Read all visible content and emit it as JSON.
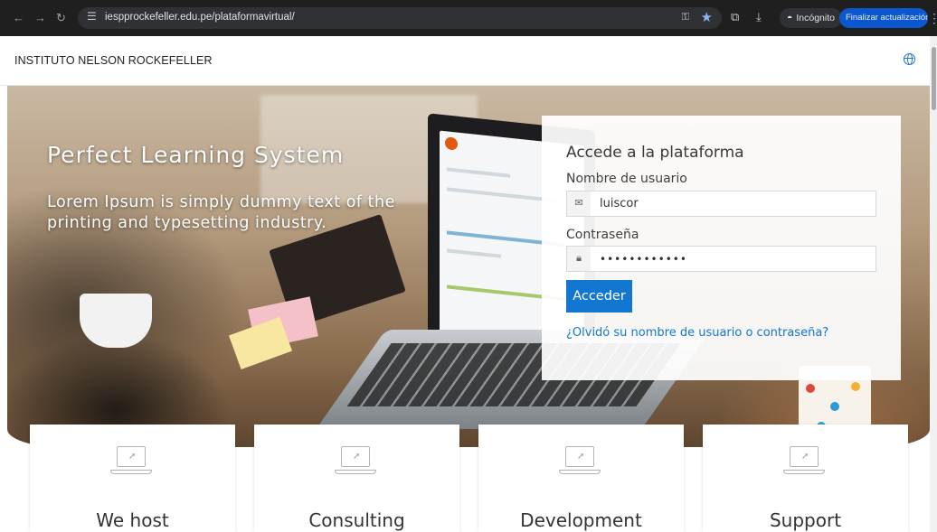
{
  "browser": {
    "url": "iespprockefeller.edu.pe/plataformavirtual/",
    "incognito_label": "Incógnito",
    "update_label": "Finalizar actualización",
    "accent": "#0b57d0"
  },
  "header": {
    "brand": "INSTITUTO NELSON ROCKEFELLER",
    "language_icon": "globe-icon"
  },
  "hero": {
    "title": "Perfect Learning System",
    "subtitle": "Lorem Ipsum is simply dummy text of the printing and typesetting industry."
  },
  "login": {
    "title": "Accede a la plataforma",
    "username_label": "Nombre de usuario",
    "username_value": "luiscor",
    "password_label": "Contraseña",
    "password_value": "••••••••••••",
    "submit_label": "Acceder",
    "forgot_link": "¿Olvidó su nombre de usuario o contraseña?",
    "accent": "#1177d1"
  },
  "cards": [
    {
      "title": "We host",
      "icon": "laptop-icon"
    },
    {
      "title": "Consulting",
      "icon": "laptop-icon"
    },
    {
      "title": "Development",
      "icon": "laptop-icon"
    },
    {
      "title": "Support",
      "icon": "laptop-icon"
    }
  ]
}
